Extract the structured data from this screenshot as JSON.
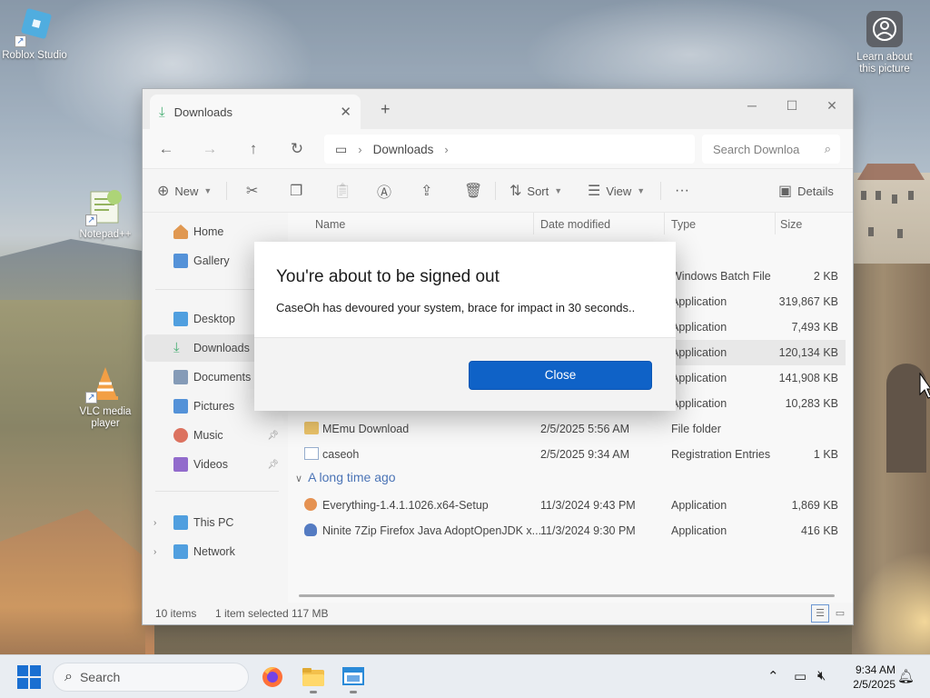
{
  "desktop": {
    "icons": [
      {
        "label": "Roblox Studio"
      },
      {
        "label": "Notepad++"
      },
      {
        "label": "VLC media player"
      },
      {
        "label": "Learn about this picture"
      }
    ]
  },
  "explorer": {
    "tab_title": "Downloads",
    "tab_close": "✕",
    "new_tab": "+",
    "window_controls": {
      "minimize": "─",
      "maximize": "☐",
      "close": "✕"
    },
    "address": {
      "root_icon": "monitor-icon",
      "segments": [
        "Downloads"
      ],
      "separator": "›"
    },
    "search_placeholder": "Search Downloa",
    "toolbar": {
      "new": "New",
      "sort": "Sort",
      "view": "View",
      "more": "···",
      "details": "Details"
    },
    "sidebar": [
      {
        "label": "Home",
        "icon": "home-icon",
        "color": "#d9822b"
      },
      {
        "label": "Gallery",
        "icon": "gallery-icon",
        "color": "#2f7ad0"
      },
      {
        "label": "Desktop",
        "icon": "desktop-icon",
        "color": "#2a8ad8"
      },
      {
        "label": "Downloads",
        "icon": "download-icon",
        "color": "#1f9d55",
        "selected": true
      },
      {
        "label": "Documents",
        "icon": "documents-icon",
        "color": "#6b86a8"
      },
      {
        "label": "Pictures",
        "icon": "pictures-icon",
        "color": "#2f7ad0"
      },
      {
        "label": "Music",
        "icon": "music-icon",
        "color": "#d5533c",
        "pinned": true
      },
      {
        "label": "Videos",
        "icon": "videos-icon",
        "color": "#7a4bc1",
        "pinned": true
      },
      {
        "label": "This PC",
        "icon": "pc-icon",
        "color": "#2a8ad8"
      },
      {
        "label": "Network",
        "icon": "network-icon",
        "color": "#2a8ad8"
      }
    ],
    "columns": {
      "name": "Name",
      "date": "Date modified",
      "type": "Type",
      "size": "Size"
    },
    "files": [
      {
        "name": "",
        "date": "",
        "type": "Windows Batch File",
        "size": "2 KB"
      },
      {
        "name": "",
        "date": "",
        "type": "Application",
        "size": "319,867 KB"
      },
      {
        "name": "",
        "date": "",
        "type": "Application",
        "size": "7,493 KB"
      },
      {
        "name": "",
        "date": "",
        "type": "Application",
        "size": "120,134 KB",
        "selected": true
      },
      {
        "name": "",
        "date": "",
        "type": "Application",
        "size": "141,908 KB"
      },
      {
        "name": "",
        "date": "",
        "type": "Application",
        "size": "10,283 KB"
      },
      {
        "name": "MEmu Download",
        "date": "2/5/2025 5:56 AM",
        "type": "File folder",
        "size": "",
        "icon": "folder-icon"
      },
      {
        "name": "caseoh",
        "date": "2/5/2025 9:34 AM",
        "type": "Registration Entries",
        "size": "1 KB",
        "icon": "registry-icon"
      }
    ],
    "group_old": "A long time ago",
    "files_old": [
      {
        "name": "Everything-1.4.1.1026.x64-Setup",
        "date": "11/3/2024 9:43 PM",
        "type": "Application",
        "size": "1,869 KB",
        "icon": "everything-icon"
      },
      {
        "name": "Ninite 7Zip Firefox Java AdoptOpenJDK x...",
        "date": "11/3/2024 9:30 PM",
        "type": "Application",
        "size": "416 KB",
        "icon": "ninite-icon"
      }
    ],
    "status": {
      "items": "10 items",
      "selected": "1 item selected",
      "size": "117 MB"
    }
  },
  "dialog": {
    "title": "You're about to be signed out",
    "message": "CaseOh has devoured your system, brace for impact in 30 seconds..",
    "button": "Close",
    "accent": "#0f62c7"
  },
  "taskbar": {
    "search_placeholder": "Search",
    "time": "9:34 AM",
    "date": "2/5/2025"
  }
}
